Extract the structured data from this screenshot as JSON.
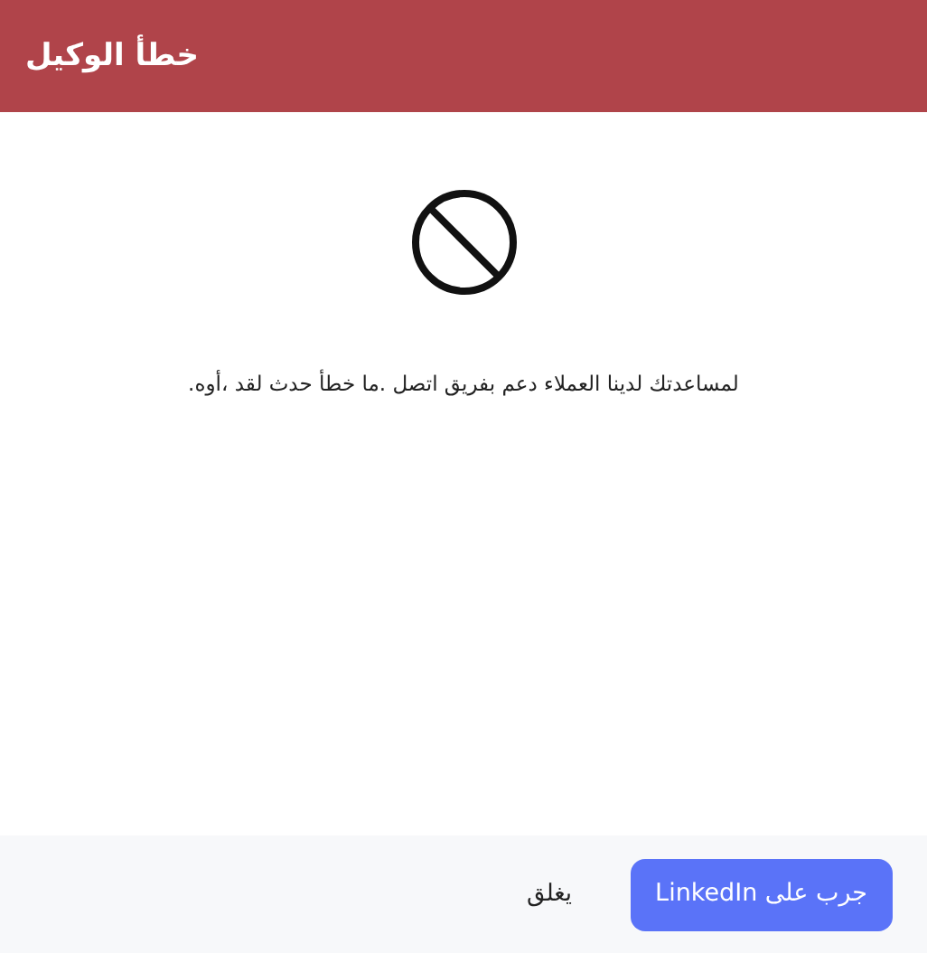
{
  "dialog": {
    "title": "خطأ الوكيل",
    "message": ".أوه، لقد حدث خطأ ما. اتصل بفريق دعم العملاء لدينا لمساعدتك",
    "buttons": [
      {
        "label": "جرب على LinkedIn",
        "kind": "primary"
      },
      {
        "label": "يغلق",
        "kind": "link"
      }
    ]
  }
}
